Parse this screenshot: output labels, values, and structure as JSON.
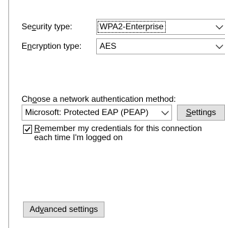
{
  "security": {
    "label_prefix": "Se",
    "label_accel": "c",
    "label_suffix": "urity type:",
    "value": "WPA2-Enterprise",
    "chevron_icon": "chevron-down-icon"
  },
  "encryption": {
    "label_prefix": "E",
    "label_accel": "n",
    "label_suffix": "cryption type:",
    "value": "AES",
    "chevron_icon": "chevron-down-icon"
  },
  "auth": {
    "label_prefix": "Ch",
    "label_accel": "o",
    "label_suffix": "ose a network authentication method:",
    "method_value": "Microsoft: Protected EAP (PEAP)",
    "settings_accel": "S",
    "settings_rest": "ettings"
  },
  "remember": {
    "checked": true,
    "text_accel": "R",
    "text_rest": "emember my credentials for this connection each time I'm logged on"
  },
  "advanced": {
    "prefix": "Ad",
    "accel": "v",
    "suffix": "anced settings"
  },
  "colors": {
    "border": "#adadad",
    "button_bg": "#e1e1e1",
    "page_bg": "#ffffff"
  }
}
